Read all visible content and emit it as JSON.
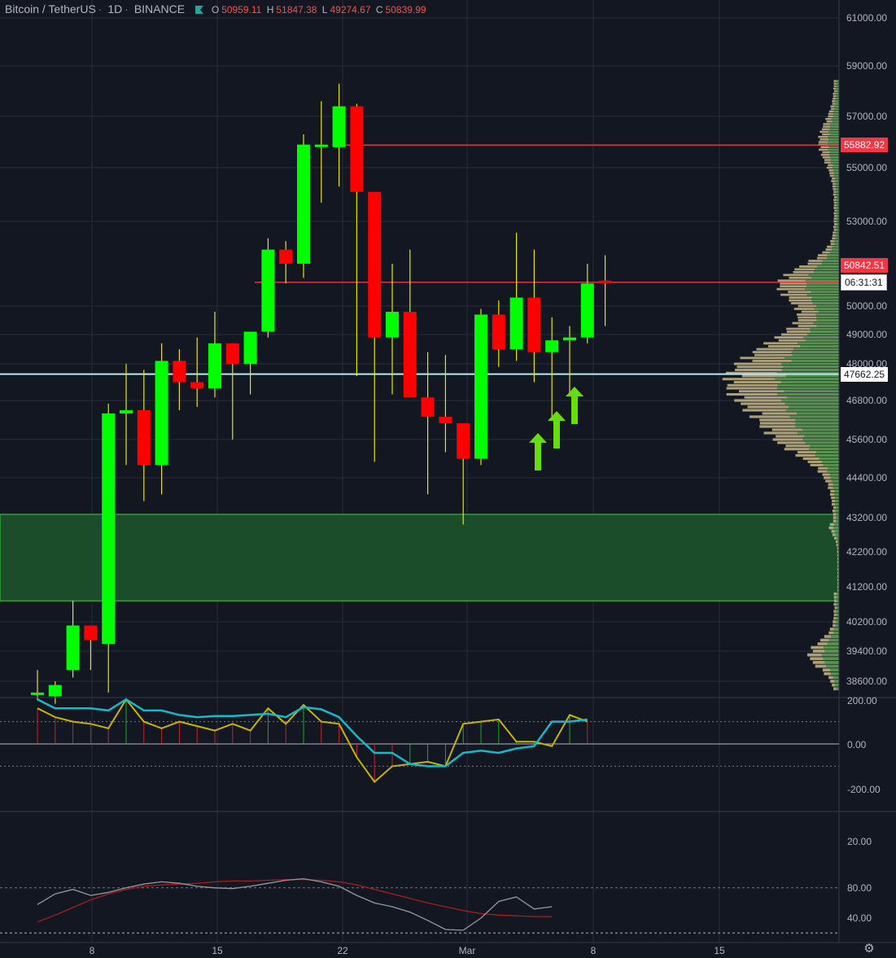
{
  "header": {
    "symbol": "Bitcoin / TetherUS",
    "interval": "1D",
    "exchange": "BINANCE",
    "ohlc": {
      "o": "50959.11",
      "h": "51847.38",
      "l": "49274.67",
      "c": "50839.99"
    },
    "ohlc_labels": {
      "o": "O",
      "h": "H",
      "l": "L",
      "c": "C"
    }
  },
  "colors": {
    "background": "#131722",
    "grid": "#2a2e39",
    "up": "#00ff00",
    "down": "#ff0000",
    "wick": "#e6e600",
    "text": "#b2b5be",
    "support_zone": "#1b4d2a",
    "support_border": "#3fd33f",
    "price_line": "#f23645",
    "cyan_line": "#b2ebf2",
    "arrow": "#66dd11",
    "volume_profile": "#c8b88a",
    "volume_profile_alt": "#4c8f4c"
  },
  "price_axis": {
    "ticks": [
      "61000.00",
      "59000.00",
      "57000.00",
      "55000.00",
      "53000.00",
      "50000.00",
      "49000.00",
      "48000.00",
      "46800.00",
      "45600.00",
      "44400.00",
      "43200.00",
      "42200.00",
      "41200.00",
      "40200.00",
      "39400.00",
      "38600.00"
    ],
    "labels": {
      "level_red": "55882.92",
      "current_price": "50842.51",
      "countdown": "06:31:31",
      "level_cyan": "47662.25"
    }
  },
  "time_axis": {
    "ticks": [
      "8",
      "15",
      "22",
      "Mar",
      "8",
      "15"
    ]
  },
  "cci_axis": {
    "ticks": [
      "200.00",
      "0.00",
      "-200.00"
    ]
  },
  "stoch_axis": {
    "ticks": [
      "20.00",
      "80.00",
      "40.00"
    ]
  },
  "chart_data": {
    "type": "candlestick",
    "title": "Bitcoin / TetherUS, 1D, BINANCE",
    "candles": [
      {
        "o": 38300,
        "h": 38900,
        "l": 38100,
        "c": 38300
      },
      {
        "o": 38200,
        "h": 38600,
        "l": 38000,
        "c": 38500
      },
      {
        "o": 38900,
        "h": 40800,
        "l": 38700,
        "c": 40100
      },
      {
        "o": 40100,
        "h": 40000,
        "l": 38900,
        "c": 39700
      },
      {
        "o": 39600,
        "h": 46700,
        "l": 38300,
        "c": 46400
      },
      {
        "o": 46400,
        "h": 48000,
        "l": 44800,
        "c": 46500
      },
      {
        "o": 46500,
        "h": 47800,
        "l": 43700,
        "c": 44800
      },
      {
        "o": 44800,
        "h": 48700,
        "l": 43900,
        "c": 48100
      },
      {
        "o": 48100,
        "h": 48500,
        "l": 46500,
        "c": 47400
      },
      {
        "o": 47400,
        "h": 48900,
        "l": 46600,
        "c": 47200
      },
      {
        "o": 47200,
        "h": 49800,
        "l": 46900,
        "c": 48700
      },
      {
        "o": 48700,
        "h": 48700,
        "l": 45600,
        "c": 48000
      },
      {
        "o": 48000,
        "h": 48900,
        "l": 47000,
        "c": 49100
      },
      {
        "o": 49100,
        "h": 52400,
        "l": 48900,
        "c": 52000
      },
      {
        "o": 52000,
        "h": 52300,
        "l": 50800,
        "c": 51500
      },
      {
        "o": 51500,
        "h": 56300,
        "l": 51000,
        "c": 55900
      },
      {
        "o": 55900,
        "h": 57600,
        "l": 53700,
        "c": 55900
      },
      {
        "o": 55800,
        "h": 58300,
        "l": 54300,
        "c": 57400
      },
      {
        "o": 57400,
        "h": 57500,
        "l": 47600,
        "c": 54100
      },
      {
        "o": 54100,
        "h": 54000,
        "l": 44900,
        "c": 48900
      },
      {
        "o": 48900,
        "h": 51500,
        "l": 47000,
        "c": 49800
      },
      {
        "o": 49800,
        "h": 52000,
        "l": 46900,
        "c": 46900
      },
      {
        "o": 46900,
        "h": 48400,
        "l": 43900,
        "c": 46300
      },
      {
        "o": 46300,
        "h": 48300,
        "l": 45200,
        "c": 46100
      },
      {
        "o": 46100,
        "h": 46000,
        "l": 43000,
        "c": 45000
      },
      {
        "o": 45000,
        "h": 49900,
        "l": 44800,
        "c": 49700
      },
      {
        "o": 49700,
        "h": 50200,
        "l": 47900,
        "c": 48500
      },
      {
        "o": 48500,
        "h": 52600,
        "l": 48100,
        "c": 50300
      },
      {
        "o": 50300,
        "h": 52000,
        "l": 47400,
        "c": 48400
      },
      {
        "o": 48400,
        "h": 49600,
        "l": 46300,
        "c": 48800
      },
      {
        "o": 48800,
        "h": 49300,
        "l": 47000,
        "c": 48900
      },
      {
        "o": 48900,
        "h": 51500,
        "l": 48700,
        "c": 50800
      },
      {
        "o": 50900,
        "h": 51800,
        "l": 49300,
        "c": 50800
      }
    ],
    "support_zone": [
      40800,
      43300
    ],
    "horizontal_levels": [
      55882.92,
      50842.51,
      47662.25
    ],
    "cci": {
      "fast": [
        160,
        120,
        100,
        90,
        70,
        200,
        100,
        70,
        100,
        80,
        60,
        90,
        60,
        160,
        90,
        175,
        100,
        90,
        -60,
        -170,
        -100,
        -90,
        -80,
        -100,
        90,
        100,
        110,
        10,
        10,
        -10,
        130,
        100
      ],
      "slow": [
        200,
        160,
        160,
        160,
        150,
        200,
        150,
        150,
        130,
        120,
        125,
        125,
        130,
        135,
        120,
        165,
        155,
        120,
        35,
        -40,
        -40,
        -90,
        -100,
        -100,
        -40,
        -30,
        -40,
        -20,
        -10,
        100,
        100,
        110
      ]
    },
    "stoch": {
      "k": [
        58,
        72,
        78,
        70,
        74,
        80,
        85,
        88,
        86,
        82,
        80,
        79,
        82,
        86,
        90,
        92,
        88,
        82,
        70,
        60,
        55,
        48,
        37,
        25,
        24,
        40,
        62,
        68,
        52,
        55
      ],
      "d": [
        35,
        44,
        54,
        64,
        72,
        78,
        82,
        84,
        85,
        86,
        88,
        89,
        89,
        90,
        91,
        91,
        90,
        88,
        84,
        78,
        72,
        66,
        60,
        55,
        50,
        46,
        44,
        43,
        42,
        42
      ]
    }
  }
}
